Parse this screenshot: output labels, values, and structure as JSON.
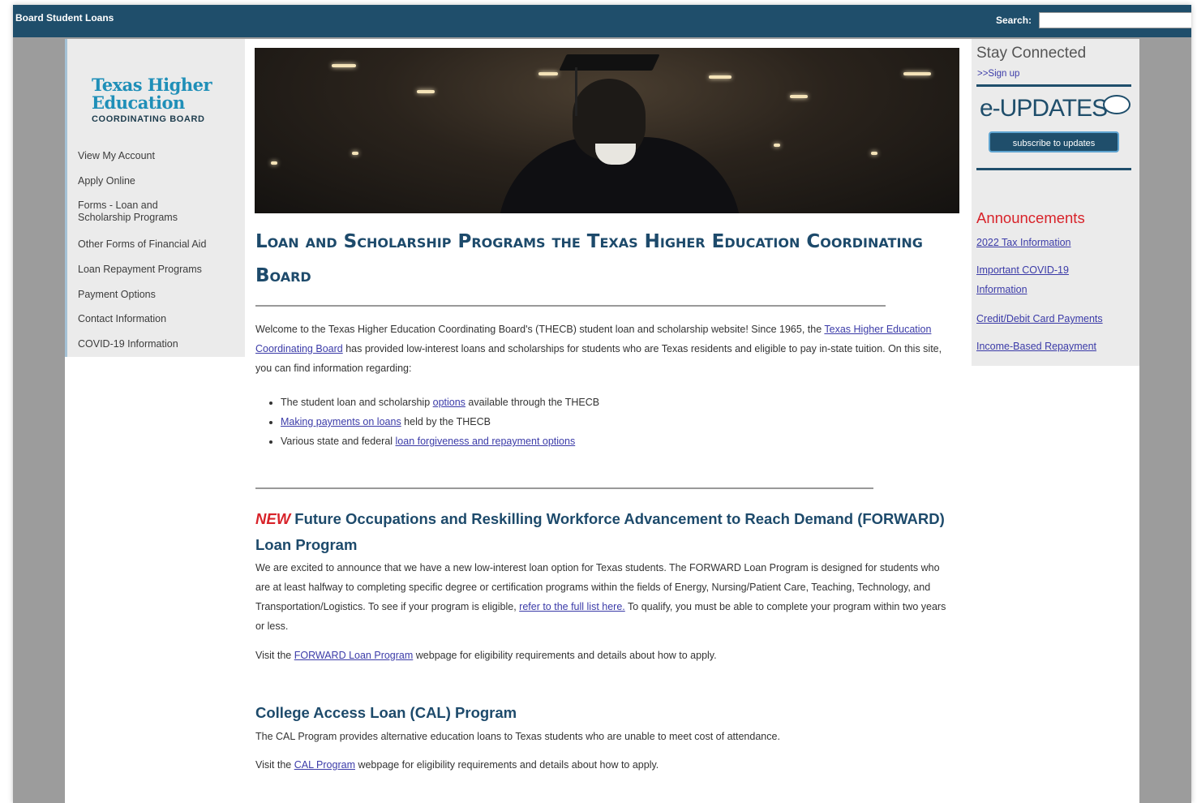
{
  "topbar": {
    "site_title": "Board Student Loans",
    "search_label": "Search:"
  },
  "logo": {
    "line1": "Texas Higher",
    "line2": "Education",
    "line3": "COORDINATING BOARD"
  },
  "sidebar": {
    "items": [
      {
        "label": "View My Account"
      },
      {
        "label": "Apply Online"
      },
      {
        "label_a": "Forms - Loan and",
        "label_b": "Scholarship Programs"
      },
      {
        "label": "Other Forms of Financial Aid"
      },
      {
        "label": "Loan Repayment Programs"
      },
      {
        "label": "Payment Options"
      },
      {
        "label": "Contact Information"
      },
      {
        "label": "COVID-19 Information"
      }
    ]
  },
  "main": {
    "title": "Loan and Scholarship Programs the Texas Higher Education Coordinating Board",
    "intro": {
      "t1": "Welcome to the Texas Higher Education Coordinating Board's (THECB) student loan and scholarship website! Since 1965, the ",
      "link": "Texas Higher Education Coordinating Board",
      "t2": " has provided low-interest loans and scholarships for students who are Texas residents and eligible to pay in-state tuition. On this site, you can find information regarding:"
    },
    "bullets": [
      {
        "pre": "The student loan and scholarship ",
        "link": "options",
        "post": " available through the THECB"
      },
      {
        "pre": "",
        "link": "Making payments on loans",
        "post": " held by the THECB"
      },
      {
        "pre": "Various state and federal ",
        "link": "loan forgiveness and repayment options",
        "post": ""
      }
    ],
    "forward": {
      "new_tag": "NEW",
      "title": " Future Occupations and Reskilling Workforce Advancement to Reach Demand (FORWARD) Loan Program",
      "p1": "We are excited to announce that we have a new low-interest loan option for Texas students. The FORWARD Loan Program is designed for students who are at least halfway to completing specific degree or certification programs within the fields of Energy, Nursing/Patient Care, Teaching, Technology, and Transportation/Logistics. To see if your program is eligible, ",
      "p1_link": "refer to the full list here.",
      "p1_post": "  To qualify, you must be able to complete your program within two years or less.",
      "p2_pre": "Visit the ",
      "p2_link": "FORWARD Loan Program",
      "p2_post": " webpage for eligibility requirements and details about how to apply."
    },
    "cal": {
      "title": "College Access Loan (CAL) Program",
      "p1": "The CAL Program provides alternative education loans to Texas students who are unable to meet cost of attendance.",
      "p2_pre": "Visit the ",
      "p2_link": "CAL Program",
      "p2_post": " webpage for eligibility requirements and details about how to apply."
    }
  },
  "right": {
    "stay_connected": "Stay Connected",
    "signup": ">>Sign up",
    "eupdates_title": "e-UPDATES",
    "subscribe_button": "subscribe to updates",
    "announcements_title": "Announcements",
    "announcements": [
      {
        "label": "2022 Tax Information"
      },
      {
        "label_a": "Important COVID-19",
        "label_b": "Information"
      },
      {
        "label": "Credit/Debit Card Payments"
      },
      {
        "label": "Income-Based Repayment"
      }
    ]
  },
  "colors": {
    "header_bar": "#1f4e6b",
    "heading": "#1d4a6b",
    "accent_red": "#d8232a",
    "link": "#3b3ba8",
    "logo_blue": "#1f8fb8"
  }
}
